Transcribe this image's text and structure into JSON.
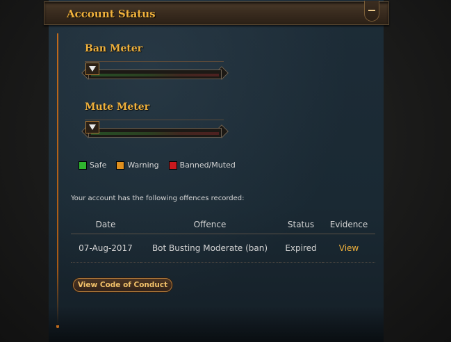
{
  "header": {
    "title": "Account Status"
  },
  "ban_meter": {
    "title": "Ban Meter",
    "level": 0
  },
  "mute_meter": {
    "title": "Mute Meter",
    "level": 0
  },
  "legend": [
    {
      "label": "Safe",
      "color": "#2fb52f"
    },
    {
      "label": "Warning",
      "color": "#e0901e"
    },
    {
      "label": "Banned/Muted",
      "color": "#c8191e"
    }
  ],
  "offences": {
    "intro": "Your account has the following offences recorded:",
    "columns": [
      "Date",
      "Offence",
      "Status",
      "Evidence"
    ],
    "rows": [
      {
        "date": "07-Aug-2017",
        "offence": "Bot Busting Moderate (ban)",
        "status": "Expired",
        "evidence": "View"
      }
    ]
  },
  "code_of_conduct_button": "View Code of Conduct"
}
